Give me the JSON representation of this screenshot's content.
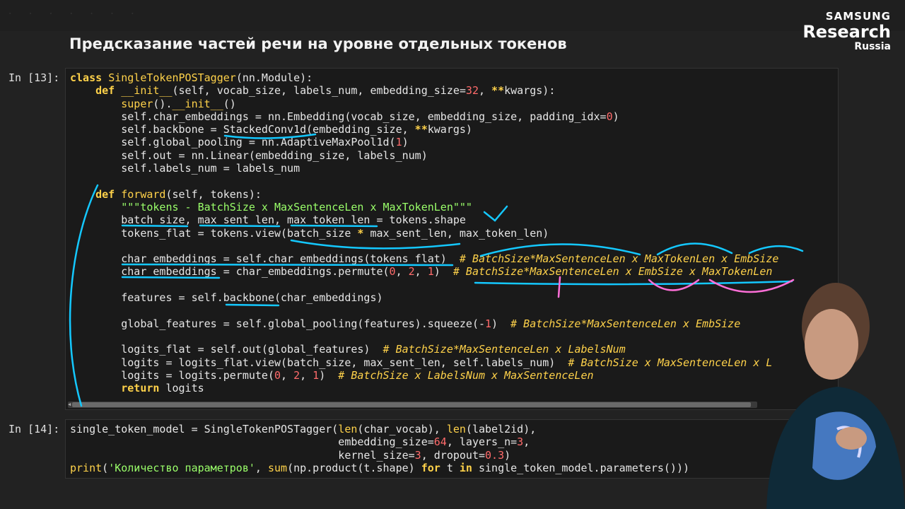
{
  "slide": {
    "title": "Предсказание частей речи на уровне отдельных токенов"
  },
  "logo": {
    "line1": "SAMSUNG",
    "line2": "Research",
    "line3": "Russia"
  },
  "cells": [
    {
      "prompt": "In [13]:",
      "lines": [
        [
          [
            "kw",
            "class "
          ],
          [
            "fn",
            "SingleTokenPOSTagger"
          ],
          [
            "",
            "(nn.Module):"
          ]
        ],
        [
          [
            "",
            "    "
          ],
          [
            "kw",
            "def "
          ],
          [
            "fn",
            "__init__"
          ],
          [
            "",
            "(self, vocab_size, labels_num, embedding_size="
          ],
          [
            "num",
            "32"
          ],
          [
            "",
            ", "
          ],
          [
            "kw",
            "**"
          ],
          [
            "",
            "kwargs):"
          ]
        ],
        [
          [
            "",
            "        "
          ],
          [
            "fn",
            "super"
          ],
          [
            "",
            "()."
          ],
          [
            "fn",
            "__init__"
          ],
          [
            "",
            "()"
          ]
        ],
        [
          [
            "",
            "        self.char_embeddings = nn.Embedding(vocab_size, embedding_size, padding_idx="
          ],
          [
            "num",
            "0"
          ],
          [
            "",
            ")"
          ]
        ],
        [
          [
            "",
            "        self.backbone = StackedConv1d(embedding_size, "
          ],
          [
            "kw",
            "**"
          ],
          [
            "",
            "kwargs)"
          ]
        ],
        [
          [
            "",
            "        self.global_pooling = nn.AdaptiveMaxPool1d("
          ],
          [
            "num",
            "1"
          ],
          [
            "",
            ")"
          ]
        ],
        [
          [
            "",
            "        self.out = nn.Linear(embedding_size, labels_num)"
          ]
        ],
        [
          [
            "",
            "        self.labels_num = labels_num"
          ]
        ],
        [
          [
            "",
            ""
          ]
        ],
        [
          [
            "",
            "    "
          ],
          [
            "kw",
            "def "
          ],
          [
            "fn",
            "forward"
          ],
          [
            "",
            "(self, tokens):"
          ]
        ],
        [
          [
            "",
            "        "
          ],
          [
            "str",
            "\"\"\"tokens - BatchSize x MaxSentenceLen x MaxTokenLen\"\"\""
          ]
        ],
        [
          [
            "",
            "        batch_size, max_sent_len, max_token_len = tokens.shape"
          ]
        ],
        [
          [
            "",
            "        tokens_flat = tokens.view(batch_size "
          ],
          [
            "kw",
            "*"
          ],
          [
            "",
            " max_sent_len, max_token_len)"
          ]
        ],
        [
          [
            "",
            ""
          ]
        ],
        [
          [
            "",
            "        char_embeddings = self.char_embeddings(tokens_flat)  "
          ],
          [
            "cm",
            "# BatchSize*MaxSentenceLen x MaxTokenLen x EmbSize"
          ]
        ],
        [
          [
            "",
            "        char_embeddings = char_embeddings.permute("
          ],
          [
            "num",
            "0"
          ],
          [
            "",
            ", "
          ],
          [
            "num",
            "2"
          ],
          [
            "",
            ", "
          ],
          [
            "num",
            "1"
          ],
          [
            "",
            ")  "
          ],
          [
            "cm",
            "# BatchSize*MaxSentenceLen x EmbSize x MaxTokenLen"
          ]
        ],
        [
          [
            "",
            ""
          ]
        ],
        [
          [
            "",
            "        features = self.backbone(char_embeddings)"
          ]
        ],
        [
          [
            "",
            ""
          ]
        ],
        [
          [
            "",
            "        global_features = self.global_pooling(features).squeeze(-"
          ],
          [
            "num",
            "1"
          ],
          [
            "",
            ")  "
          ],
          [
            "cm",
            "# BatchSize*MaxSentenceLen x EmbSize"
          ]
        ],
        [
          [
            "",
            ""
          ]
        ],
        [
          [
            "",
            "        logits_flat = self.out(global_features)  "
          ],
          [
            "cm",
            "# BatchSize*MaxSentenceLen x LabelsNum"
          ]
        ],
        [
          [
            "",
            "        logits = logits_flat.view(batch_size, max_sent_len, self.labels_num)  "
          ],
          [
            "cm",
            "# BatchSize x MaxSentenceLen x L"
          ]
        ],
        [
          [
            "",
            "        logits = logits.permute("
          ],
          [
            "num",
            "0"
          ],
          [
            "",
            ", "
          ],
          [
            "num",
            "2"
          ],
          [
            "",
            ", "
          ],
          [
            "num",
            "1"
          ],
          [
            "",
            ")  "
          ],
          [
            "cm",
            "# BatchSize x LabelsNum x MaxSentenceLen"
          ]
        ],
        [
          [
            "",
            "        "
          ],
          [
            "kw",
            "return "
          ],
          [
            "",
            "logits"
          ]
        ]
      ]
    },
    {
      "prompt": "In [14]:",
      "lines": [
        [
          [
            "",
            "single_token_model = SingleTokenPOSTagger("
          ],
          [
            "fn",
            "len"
          ],
          [
            "",
            "(char_vocab), "
          ],
          [
            "fn",
            "len"
          ],
          [
            "",
            "(label2id),"
          ]
        ],
        [
          [
            "",
            "                                          embedding_size="
          ],
          [
            "num",
            "64"
          ],
          [
            "",
            ", layers_n="
          ],
          [
            "num",
            "3"
          ],
          [
            "",
            ","
          ]
        ],
        [
          [
            "",
            "                                          kernel_size="
          ],
          [
            "num",
            "3"
          ],
          [
            "",
            ", dropout="
          ],
          [
            "num",
            "0.3"
          ],
          [
            "",
            ")"
          ]
        ],
        [
          [
            "fn",
            "print"
          ],
          [
            "",
            "("
          ],
          [
            "str",
            "'Количество параметров'"
          ],
          [
            "",
            ", "
          ],
          [
            "fn",
            "sum"
          ],
          [
            "",
            "(np.product(t.shape) "
          ],
          [
            "kw",
            "for "
          ],
          [
            "",
            "t "
          ],
          [
            "kw",
            "in "
          ],
          [
            "",
            "single_token_model.parameters()))"
          ]
        ]
      ]
    }
  ],
  "colors": {
    "background": "#222222",
    "keyword": "#ffd24a",
    "number": "#ff6b6b",
    "string": "#9aff6a",
    "annotation_cyan": "#14c8ff",
    "annotation_pink": "#ff6fd8"
  }
}
